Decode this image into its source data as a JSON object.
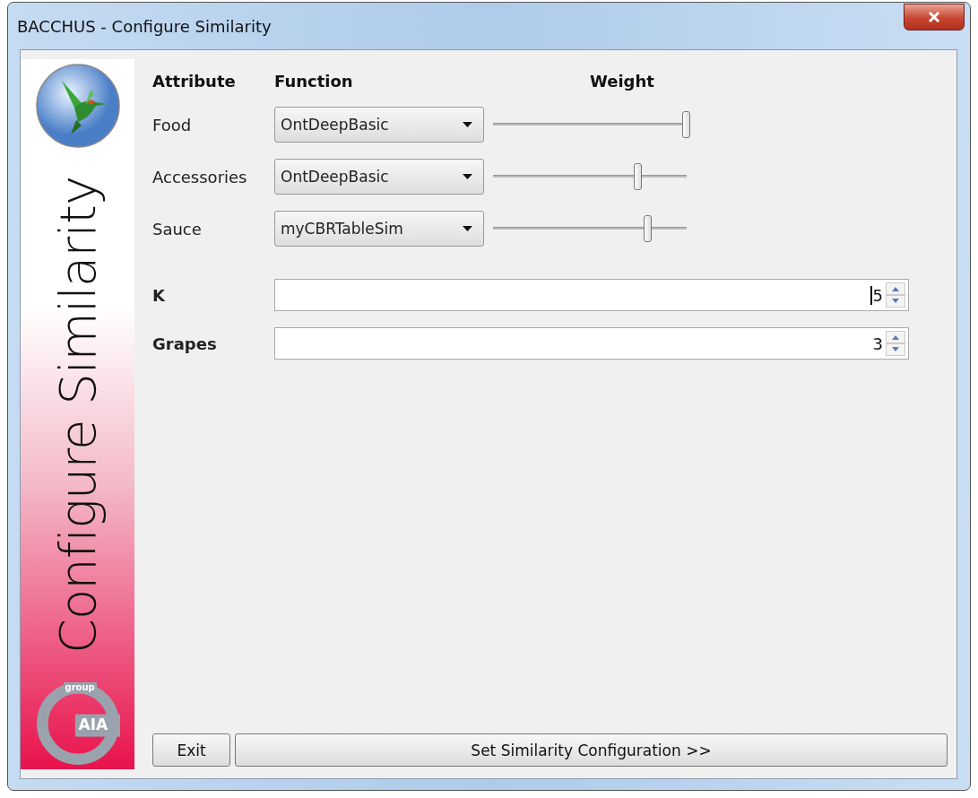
{
  "window": {
    "title": "BACCHUS - Configure Similarity"
  },
  "sidebar": {
    "title": "Configure Similarity",
    "logo_text": "AIA",
    "logo_caption": "group"
  },
  "headers": {
    "attribute": "Attribute",
    "function": "Function",
    "weight": "Weight"
  },
  "attributes": [
    {
      "name": "Food",
      "function": "OntDeepBasic",
      "level": 1.0
    },
    {
      "name": "Accessories",
      "function": "OntDeepBasic",
      "level": 0.75
    },
    {
      "name": "Sauce",
      "function": "myCBRTableSim",
      "level": 0.8
    }
  ],
  "spinners": [
    {
      "label": "K",
      "value": "5",
      "focused": true
    },
    {
      "label": "Grapes",
      "value": "3",
      "focused": false
    }
  ],
  "buttons": [
    {
      "label": "Exit",
      "kind": "small"
    },
    {
      "label": "Set Similarity Configuration >>",
      "kind": "wide"
    }
  ]
}
